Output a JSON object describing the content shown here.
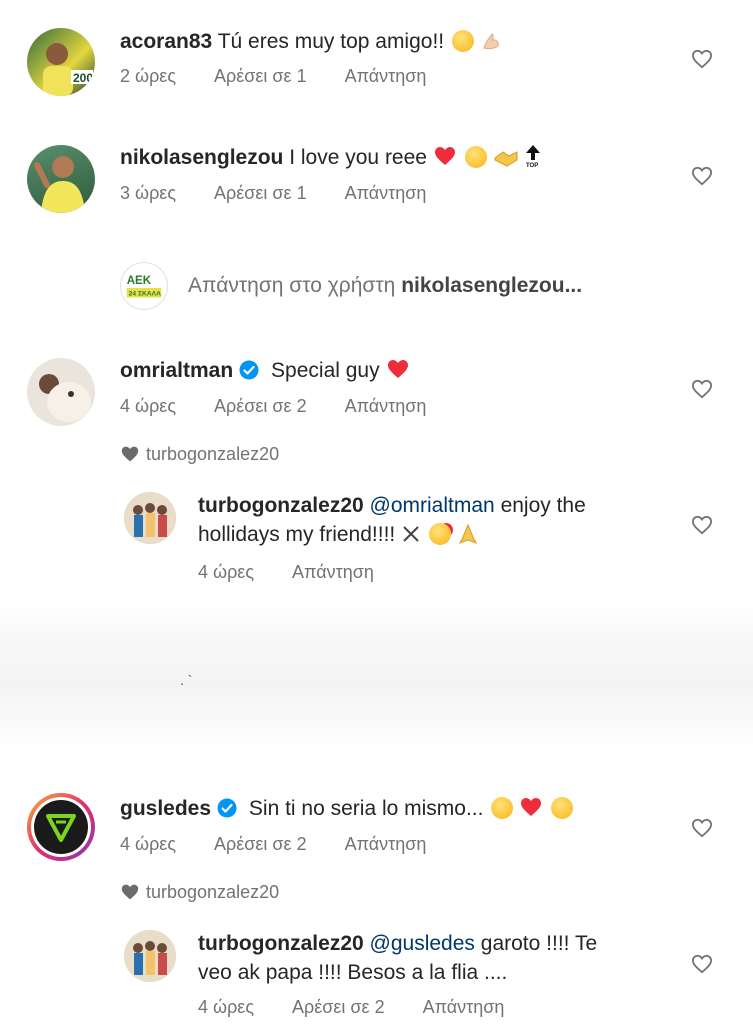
{
  "comments": [
    {
      "username": "acoran83",
      "text": "Tú eres muy top amigo!!",
      "time": "2 ώρες",
      "likes": "Αρέσει σε 1",
      "reply": "Απάντηση",
      "emoji": [
        "smiling-face",
        "flexed-biceps"
      ]
    },
    {
      "username": "nikolasenglezou",
      "text": "I love you reee",
      "time": "3 ώρες",
      "likes": "Αρέσει σε 1",
      "reply": "Απάντηση",
      "emoji": [
        "red-heart",
        "relieved-face",
        "handshake",
        "top-arrow"
      ]
    },
    {
      "username": "omrialtman",
      "text": "Special guy",
      "time": "4 ώρες",
      "likes": "Αρέσει σε 2",
      "reply": "Απάντηση",
      "emoji": [
        "red-heart"
      ],
      "liked_by": "turbogonzalez20"
    },
    {
      "username": "gusledes",
      "text": "Sin ti no seria lo mismo...",
      "time": "4 ώρες",
      "likes": "Αρέσει σε 2",
      "reply": "Απάντηση",
      "emoji": [
        "heart-eyes",
        "red-heart",
        "sad-face"
      ],
      "liked_by": "turbogonzalez20"
    }
  ],
  "thread_reply_link": {
    "prefix": "Απάντηση στο",
    "middle": "χρήστη",
    "user": "nikolasenglezou..."
  },
  "replies": [
    {
      "username": "turbogonzalez20",
      "mention": "@omrialtman",
      "text_line1": "enjoy the",
      "text_line2": "hollidays my friend!!!!",
      "time": "4 ώρες",
      "reply": "Απάντηση",
      "emoji": [
        "crossed-swords",
        "smiling-hearts",
        "folded-hands"
      ]
    },
    {
      "username": "turbogonzalez20",
      "mention": "@gusledes",
      "text_line1": "garoto !!!! Te",
      "text_line2": "veo ak papa !!!! Besos a la flia ....",
      "time": "4 ώρες",
      "likes": "Αρέσει σε 2",
      "reply": "Απάντηση"
    }
  ],
  "colors": {
    "text": "#262626",
    "secondary": "#737373",
    "mention": "#00376b",
    "verified": "#0095f6",
    "heart_red": "#ed4956"
  }
}
